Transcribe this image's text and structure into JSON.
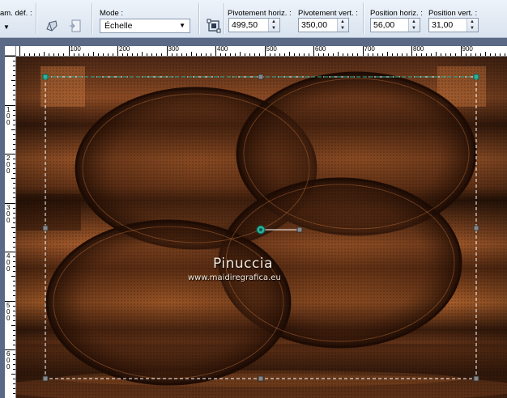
{
  "toolbar": {
    "preset_label": "am. déf. :",
    "mode_label": "Mode :",
    "mode_value": "Échelle",
    "pivot_h_label": "Pivotement horiz. :",
    "pivot_h_value": "499,50",
    "pivot_v_label": "Pivotement vert. :",
    "pivot_v_value": "350,00",
    "pos_h_label": "Position horiz. :",
    "pos_h_value": "56,00",
    "pos_v_label": "Position vert. :",
    "pos_v_value": "31,00"
  },
  "ruler": {
    "h_labels": [
      "100",
      "200",
      "300",
      "400",
      "500",
      "600",
      "700",
      "800",
      "900"
    ],
    "v_labels": [
      "1\n0\n0",
      "2\n0\n0",
      "3\n0\n0",
      "4\n0\n0",
      "5\n0\n0",
      "6\n0\n0"
    ]
  },
  "watermark": {
    "name": "Pinuccia",
    "url": "www.maidiregrafica.eu"
  },
  "colors": {
    "toolbar_bg": "#dce6f2",
    "workspace_bg": "#5a6a86",
    "image_dark": "#2a1408",
    "image_copper": "#b0622c",
    "handle_teal": "#2ab39a"
  }
}
